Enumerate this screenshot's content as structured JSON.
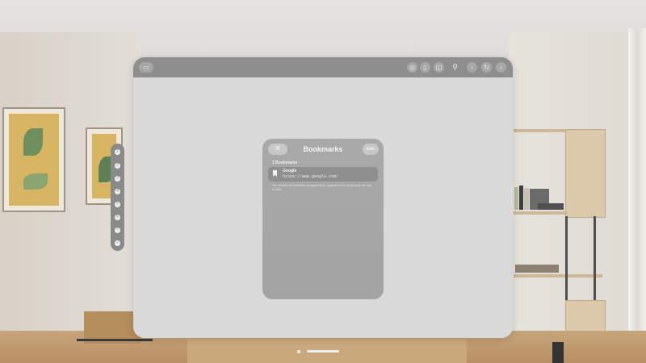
{
  "toolbar": {
    "tabs_icon": "tabs-overview-icon",
    "share_icon": "share-icon",
    "bookmark_icon": "bookmark-icon",
    "sidebar_icon": "sidebar-icon",
    "search_icon": "search-icon",
    "back_icon": "chevron-left-icon",
    "reload_icon": "reload-icon",
    "forward_icon": "chevron-right-icon"
  },
  "bookmarks_panel": {
    "title": "Bookmarks",
    "close_label": "✕",
    "edit_label": "Edit",
    "section_header": "1 Bookmarks",
    "items": [
      {
        "title": "Google",
        "url": "https://www.google.com/"
      }
    ],
    "note": "The number of bookmarks is capped at 6. Upgrade to Pro to increase the cap to 1000."
  },
  "sidebar": {
    "items": [
      "1",
      "2",
      "3",
      "4",
      "5",
      "6",
      "7",
      "+"
    ]
  },
  "colors": {
    "toolbar": "#8e8e8e",
    "panel": "#a7a7a7",
    "content": "#d9d9d9"
  }
}
